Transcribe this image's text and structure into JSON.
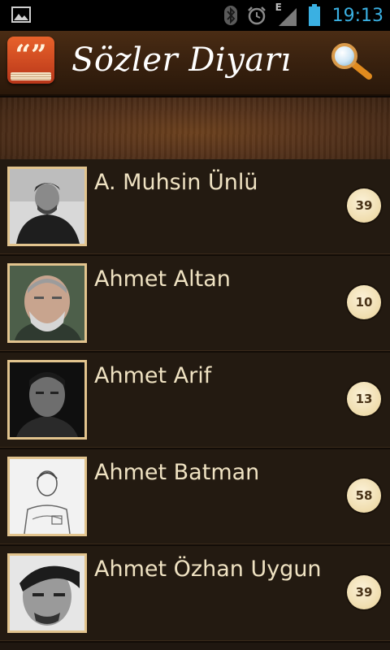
{
  "status_bar": {
    "time": "19:13",
    "icons": [
      "image-icon",
      "bluetooth-icon",
      "alarm-icon",
      "edge-signal-icon",
      "battery-icon"
    ],
    "network_label": "E"
  },
  "app_bar": {
    "title": "Sözler Diyarı",
    "icon_glyph": "“”",
    "search_icon": "search-icon"
  },
  "authors": [
    {
      "name": "A. Muhsin Ünlü",
      "count": "39"
    },
    {
      "name": "Ahmet Altan",
      "count": "10"
    },
    {
      "name": "Ahmet Arif",
      "count": "13"
    },
    {
      "name": "Ahmet Batman",
      "count": "58"
    },
    {
      "name": "Ahmet Özhan Uygun",
      "count": "39"
    }
  ],
  "colors": {
    "time": "#3ab0e2",
    "name_text": "#efe2c2",
    "thumb_border": "#e2c48e",
    "badge_bg": "#efdcac"
  }
}
